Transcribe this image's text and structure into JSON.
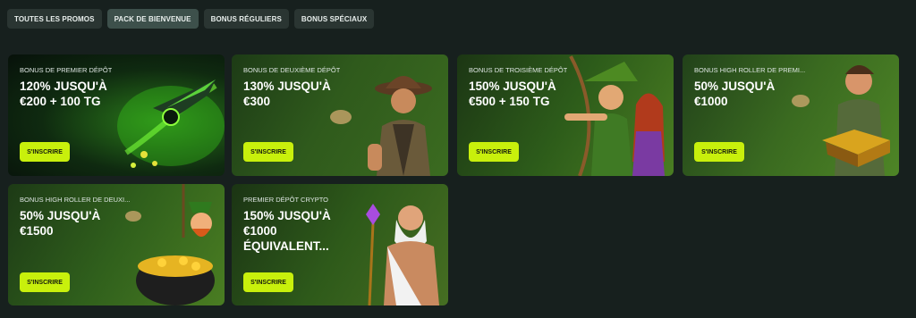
{
  "tabs": [
    {
      "label": "TOUTES LES PROMOS",
      "active": false
    },
    {
      "label": "PACK DE BIENVENUE",
      "active": true
    },
    {
      "label": "BONUS RÉGULIERS",
      "active": false
    },
    {
      "label": "BONUS SPÉCIAUX",
      "active": false
    }
  ],
  "cards": [
    {
      "caption": "BONUS DE PREMIER DÉPÔT",
      "title": "120% JUSQU'À\n€200 + 100 TG",
      "button": "S'INSCRIRE",
      "art": "spaceship-art"
    },
    {
      "caption": "BONUS DE DEUXIÈME DÉPÔT",
      "title": "130% JUSQU'À\n€300",
      "button": "S'INSCRIRE",
      "art": "explorer-art"
    },
    {
      "caption": "BONUS DE TROISIÈME DÉPÔT",
      "title": "150% JUSQU'À\n€500 + 150 TG",
      "button": "S'INSCRIRE",
      "art": "archer-art"
    },
    {
      "caption": "BONUS HIGH ROLLER DE PREMI...",
      "title": "50% JUSQU'À\n€1000",
      "button": "S'INSCRIRE",
      "art": "book-hero-art"
    },
    {
      "caption": "BONUS HIGH ROLLER DE DEUXI...",
      "title": "50% JUSQU'À\n€1500",
      "button": "S'INSCRIRE",
      "art": "leprechaun-art"
    },
    {
      "caption": "PREMIER DÉPÔT CRYPTO",
      "title": "150% JUSQU'À\n€1000\nÉQUIVALENT...",
      "button": "S'INSCRIRE",
      "art": "zeus-art"
    }
  ],
  "colors": {
    "page_bg": "#17201e",
    "tab_bg": "#2a3532",
    "tab_active_bg": "#3d504b",
    "button_bg": "#c8f00c",
    "button_text": "#141a0d"
  }
}
